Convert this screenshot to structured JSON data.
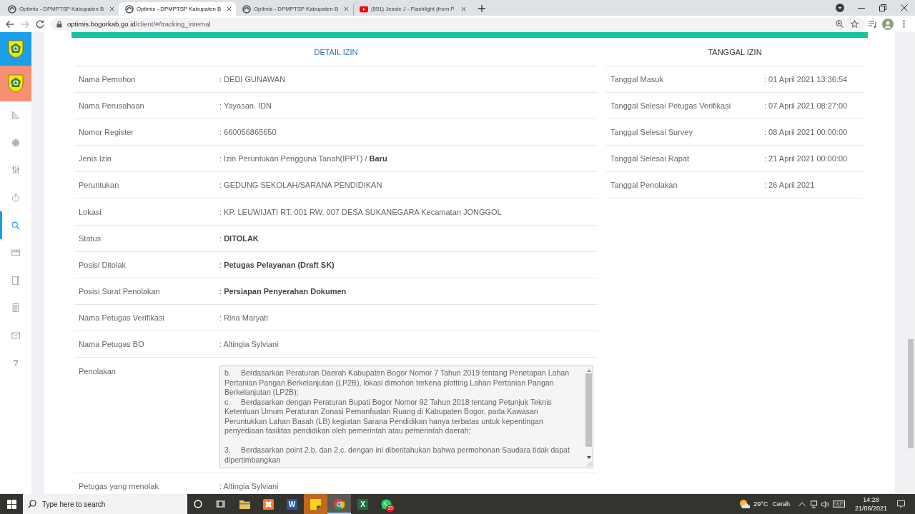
{
  "browser": {
    "tabs": [
      {
        "title": "Optimis - DPMPTSP Kabupaten B",
        "selected": false,
        "kind": "site"
      },
      {
        "title": "Optimis - DPMPTSP Kabupaten B",
        "selected": true,
        "kind": "site"
      },
      {
        "title": "Optimis - DPMPTSP Kabupaten B",
        "selected": false,
        "kind": "site"
      },
      {
        "title": "(551) Jessie J - Flashlight (from P",
        "selected": false,
        "kind": "video"
      }
    ],
    "address": {
      "host": "optimis.bogorkab.go.id",
      "path": "/client/#/tracking_internal"
    }
  },
  "sidebar": {
    "items": [
      {
        "selected": false
      },
      {
        "selected": false
      },
      {
        "selected": false
      },
      {
        "selected": false
      },
      {
        "selected": true
      },
      {
        "selected": false
      },
      {
        "selected": false
      },
      {
        "selected": false
      },
      {
        "selected": false
      },
      {
        "selected": false,
        "glyph": "?"
      }
    ]
  },
  "detail": {
    "title": "DETAIL IZIN",
    "rows": [
      {
        "kind": "text",
        "label": "Nama Pemohon",
        "value": ": DEDI GUNAWAN"
      },
      {
        "kind": "text",
        "label": "Nama Perusahaan",
        "value": ": Yayasan. IDN"
      },
      {
        "kind": "text",
        "label": "Nomor Register",
        "value": ": 660056865650"
      },
      {
        "kind": "text",
        "label": "Jenis Izin",
        "value": ": Izin Peruntukan Pengguna Tanah(IPPT) / **Baru**"
      },
      {
        "kind": "text",
        "label": "Peruntukan",
        "value": ": GEDUNG SEKOLAH/SARANA PENDIDIKAN"
      },
      {
        "kind": "text",
        "label": "Lokasi",
        "value": ": KP. LEUWIJATI RT. 001 RW. 007 DESA SUKANEGARA Kecamatan JONGGOL"
      },
      {
        "kind": "text",
        "label": "Status",
        "value": ": **DITOLAK**"
      },
      {
        "kind": "text",
        "label": "Posisi Ditolak",
        "value": ": **Petugas Pelayanan (Draft SK)**"
      },
      {
        "kind": "text",
        "label": "Posisi Surat Penolakan",
        "value": ": **Persiapan Penyerahan Dokumen**"
      },
      {
        "kind": "text",
        "label": "Nama Petugas Verifikasi",
        "value": ": Rina Maryati"
      },
      {
        "kind": "text",
        "label": "Nama Petugas BO",
        "value": ": Altingia Sylviani"
      },
      {
        "kind": "textarea",
        "label": "Penolakan",
        "points": [
          {
            "marker": "b.",
            "text": "Berdasarkan Peraturan Daerah Kabupaten Bogor Nomor 7 Tahun 2019 tentang Penetapan Lahan Pertanian Pangan Berkelanjutan (LP2B), lokasi dimohon terkena plotting Lahan Pertanian Pangan Berkelanjutan (LP2B);"
          },
          {
            "marker": "c.",
            "text": "Berdasarkan dengan Peraturan Bupati Bogor Nomor 92 Tahun 2018 tentang Petunjuk Teknis Ketentuan Umum Peraturan Zonasi Pemanfaatan Ruang di Kabupaten Bogor, pada Kawasan Peruntukkan Lahan Basah (LB) kegiatan Sarana Pendidikan hanya terbatas untuk kepentingan penyediaan fasilitas pendidikan oleh pemerintah atau pemerintah daerah;"
          }
        ],
        "conclusion": {
          "marker": "3.",
          "text": "Berdasarkan point 2.b. dan 2.c. dengan ini diberitahukan bahwa permohonan Saudara tidak dapat dipertimbangkan"
        }
      },
      {
        "kind": "text",
        "label": "Petugas yang menolak",
        "value": ": Altingia Sylviani"
      }
    ]
  },
  "dates": {
    "title": "TANGGAL IZIN",
    "rows": [
      {
        "label": "Tanggal Masuk",
        "value": ": 01 April 2021 13:36:54"
      },
      {
        "label": "Tanggal Selesai Petugas Verifikasi",
        "value": ": 07 April 2021 08:27:00"
      },
      {
        "label": "Tanggal Selesai Survey",
        "value": ": 08 April 2021 00:00:00"
      },
      {
        "label": "Tanggal Selesai Rapat",
        "value": ": 21 April 2021 00:00:00"
      },
      {
        "label": "Tanggal Penolakan",
        "value": ": 26 April 2021"
      }
    ]
  },
  "taskbar": {
    "search_placeholder": "Type here to search",
    "apps": [
      {
        "selected": false,
        "attention": false
      },
      {
        "selected": false,
        "attention": false
      },
      {
        "selected": false,
        "attention": false,
        "glyph": "W"
      },
      {
        "selected": false,
        "attention": true
      },
      {
        "selected": true,
        "attention": false
      },
      {
        "selected": false,
        "attention": false,
        "glyph": "X"
      },
      {
        "selected": false,
        "attention": false,
        "badge": "29"
      }
    ],
    "weather": {
      "temperature": "29°C",
      "condition": "Cerah"
    },
    "time": "14:28",
    "date": "21/06/2021"
  }
}
